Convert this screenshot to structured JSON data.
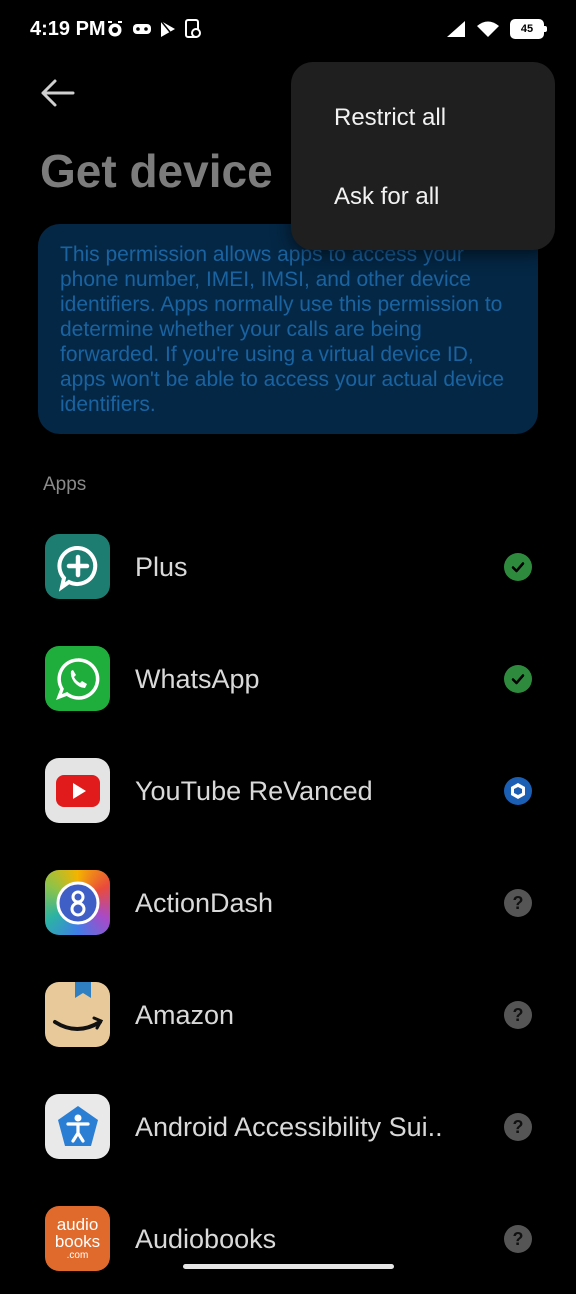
{
  "status_bar": {
    "time": "4:19 PM",
    "left_icons": [
      "alarm-icon",
      "gamepad-icon",
      "play-store-icon",
      "app-lock-icon"
    ],
    "right_icons": [
      "signal-icon",
      "wifi-icon",
      "battery-icon"
    ],
    "battery_level": "45"
  },
  "header": {
    "back_icon": "back-arrow-icon",
    "title": "Get device"
  },
  "info": {
    "text": "This permission allows apps to access your phone number, IMEI, IMSI, and other device identifiers. Apps normally use this permission to determine whether your calls are being forwarded. If you're using a virtual device ID, apps won't be able to access your actual device identifiers."
  },
  "section_label": "Apps",
  "apps": [
    {
      "name": "Plus",
      "icon": "plus-app-icon",
      "status": "allowed",
      "status_icon": "check-icon"
    },
    {
      "name": "WhatsApp",
      "icon": "whatsapp-icon",
      "status": "allowed",
      "status_icon": "check-icon"
    },
    {
      "name": "YouTube ReVanced",
      "icon": "youtube-revanced-icon",
      "status": "virtual",
      "status_icon": "virtual-id-icon"
    },
    {
      "name": "ActionDash",
      "icon": "actiondash-icon",
      "status": "ask",
      "status_icon": "question-icon"
    },
    {
      "name": "Amazon",
      "icon": "amazon-icon",
      "status": "ask",
      "status_icon": "question-icon"
    },
    {
      "name": "Android Accessibility Sui..",
      "icon": "accessibility-icon",
      "status": "ask",
      "status_icon": "question-icon"
    },
    {
      "name": "Audiobooks",
      "icon": "audiobooks-icon",
      "status": "ask",
      "status_icon": "question-icon"
    }
  ],
  "menu": {
    "items": [
      "Restrict all",
      "Ask for all"
    ]
  },
  "icon_texts": {
    "audiobooks_line1": "audio",
    "audiobooks_line2": "books",
    "audiobooks_line3": ".com",
    "question_mark": "?"
  },
  "colors": {
    "background": "#000000",
    "info_card": "#042745",
    "info_text": "#1a63a1",
    "allowed": "#2e8b3d",
    "ask": "#555555",
    "menu_bg": "#1f1f1f"
  }
}
